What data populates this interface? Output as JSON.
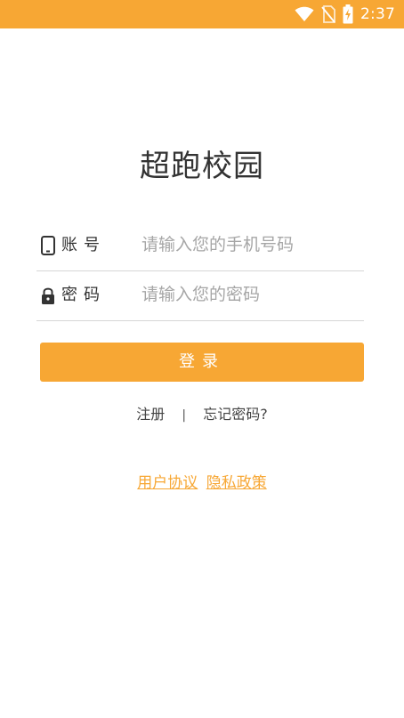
{
  "status_bar": {
    "time": "2:37",
    "icons": [
      "wifi-icon",
      "no-sim-icon",
      "battery-charging-icon"
    ],
    "background": "#f7a734"
  },
  "app": {
    "title": "超跑校园"
  },
  "form": {
    "account_label": "账号",
    "account_placeholder": "请输入您的手机号码",
    "password_label": "密码",
    "password_placeholder": "请输入您的密码",
    "login_label": "登录"
  },
  "links": {
    "register": "注册",
    "separator": "|",
    "forgot_password": "忘记密码?"
  },
  "agreement": {
    "user_agreement": "用户协议",
    "privacy_policy": "隐私政策"
  },
  "colors": {
    "accent": "#f7a734",
    "placeholder": "#a6a6a6",
    "text": "#333333",
    "divider": "#d6d6d6"
  }
}
